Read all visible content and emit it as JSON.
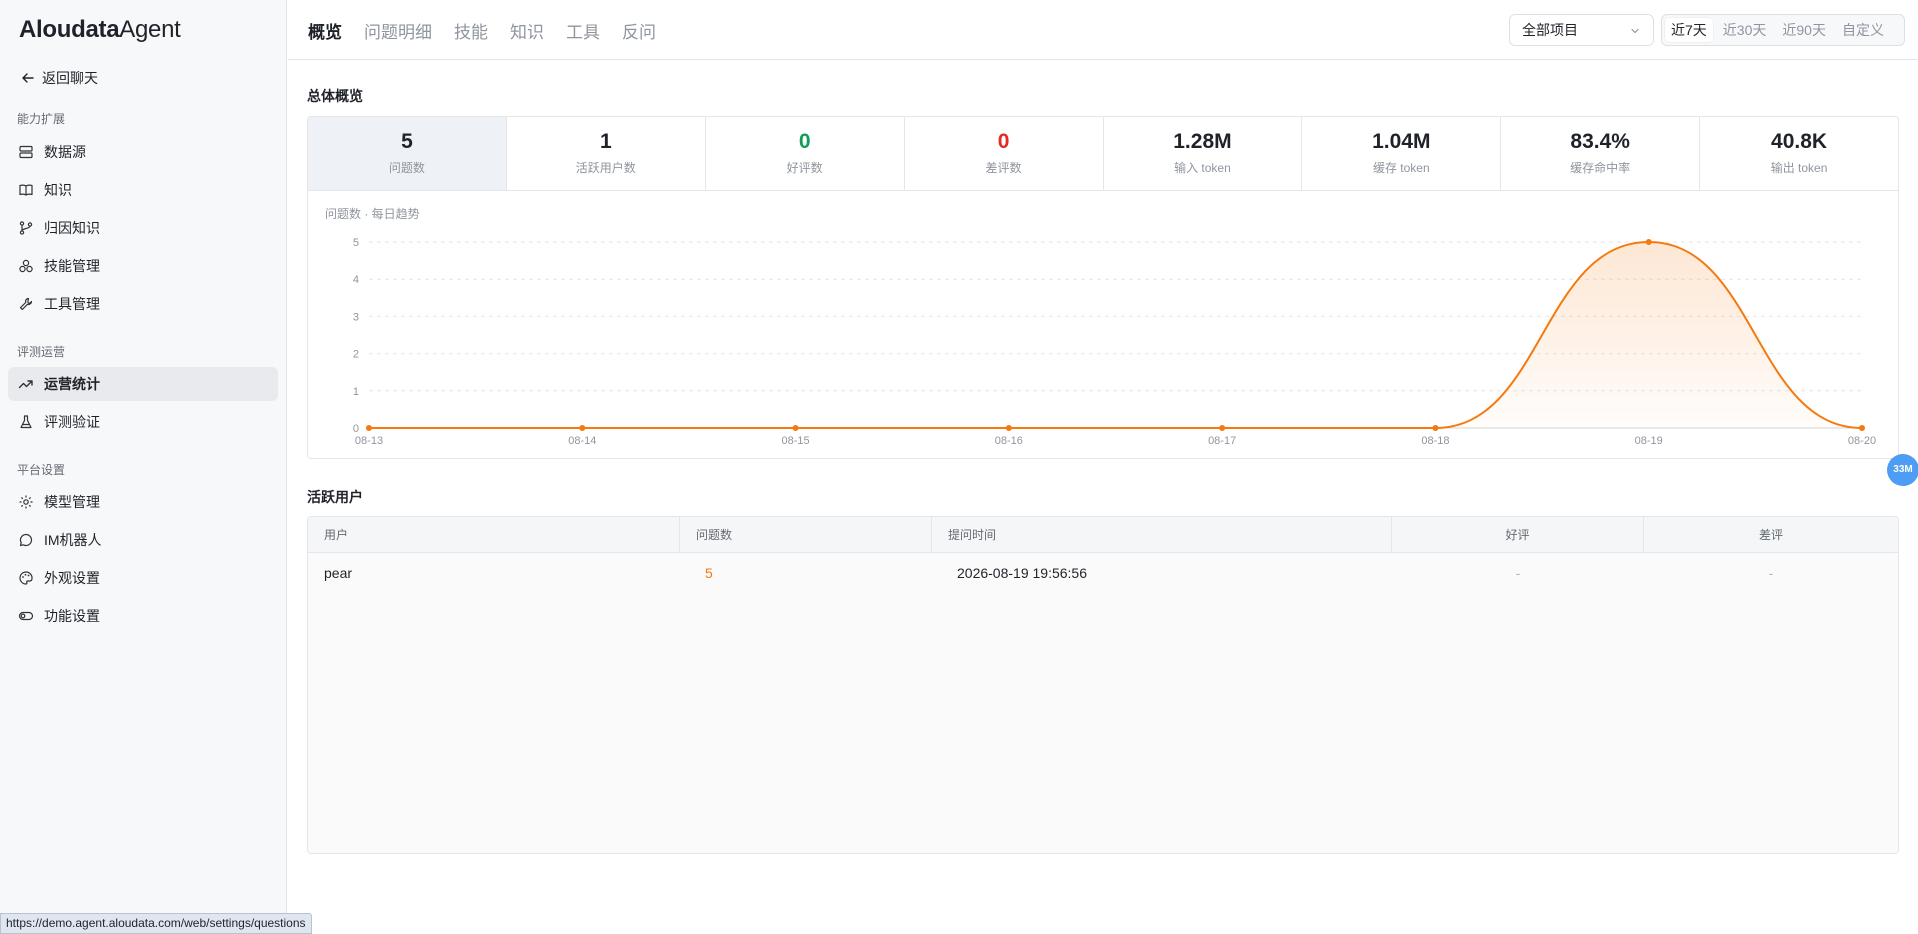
{
  "app": {
    "brand": "Aloudata",
    "product": "Agent"
  },
  "sidebar": {
    "back_label": "返回聊天",
    "groups": [
      {
        "label": "能力扩展",
        "items": [
          {
            "label": "数据源",
            "icon": "database-icon"
          },
          {
            "label": "知识",
            "icon": "book-icon"
          },
          {
            "label": "归因知识",
            "icon": "branch-icon"
          },
          {
            "label": "技能管理",
            "icon": "skills-icon"
          },
          {
            "label": "工具管理",
            "icon": "wrench-icon"
          }
        ]
      },
      {
        "label": "评测运营",
        "items": [
          {
            "label": "运营统计",
            "icon": "trend-icon",
            "active": true
          },
          {
            "label": "评测验证",
            "icon": "flask-icon"
          }
        ]
      },
      {
        "label": "平台设置",
        "items": [
          {
            "label": "模型管理",
            "icon": "gear-icon"
          },
          {
            "label": "IM机器人",
            "icon": "chat-icon"
          },
          {
            "label": "外观设置",
            "icon": "palette-icon"
          },
          {
            "label": "功能设置",
            "icon": "toggle-icon"
          }
        ]
      }
    ]
  },
  "topbar": {
    "tabs": [
      "概览",
      "问题明细",
      "技能",
      "知识",
      "工具",
      "反问"
    ],
    "active_tab": "概览",
    "project_select": "全部项目",
    "ranges": [
      "近7天",
      "近30天",
      "近90天",
      "自定义"
    ],
    "active_range": "近7天"
  },
  "overview": {
    "title": "总体概览",
    "stats": [
      {
        "value": "5",
        "label": "问题数",
        "color": "#1f2329"
      },
      {
        "value": "1",
        "label": "活跃用户数",
        "color": "#1f2329"
      },
      {
        "value": "0",
        "label": "好评数",
        "color": "#0f9d58"
      },
      {
        "value": "0",
        "label": "差评数",
        "color": "#e22b22"
      },
      {
        "value": "1.28M",
        "label": "输入 token",
        "color": "#1f2329"
      },
      {
        "value": "1.04M",
        "label": "缓存 token",
        "color": "#1f2329"
      },
      {
        "value": "83.4%",
        "label": "缓存命中率",
        "color": "#1f2329"
      },
      {
        "value": "40.8K",
        "label": "输出 token",
        "color": "#1f2329"
      }
    ]
  },
  "chart_data": {
    "type": "area",
    "title": "问题数 · 每日趋势",
    "x": [
      "08-13",
      "08-14",
      "08-15",
      "08-16",
      "08-17",
      "08-18",
      "08-19",
      "08-20"
    ],
    "series": [
      {
        "values": [
          0,
          0,
          0,
          0,
          0,
          0,
          5,
          0
        ]
      }
    ],
    "ylim": [
      0,
      5
    ],
    "yticks": [
      0,
      1,
      2,
      3,
      4,
      5
    ],
    "grid": true,
    "color": "#f47a0f"
  },
  "badge": "33M",
  "active_users": {
    "title": "活跃用户",
    "columns": [
      "用户",
      "问题数",
      "提问时间",
      "好评",
      "差评"
    ],
    "rows": [
      {
        "user": "pear",
        "questions": "5",
        "time": "2026-08-19 19:56:56",
        "good": "-",
        "bad": "-"
      }
    ]
  },
  "status_url": "https://demo.agent.aloudata.com/web/settings/questions"
}
